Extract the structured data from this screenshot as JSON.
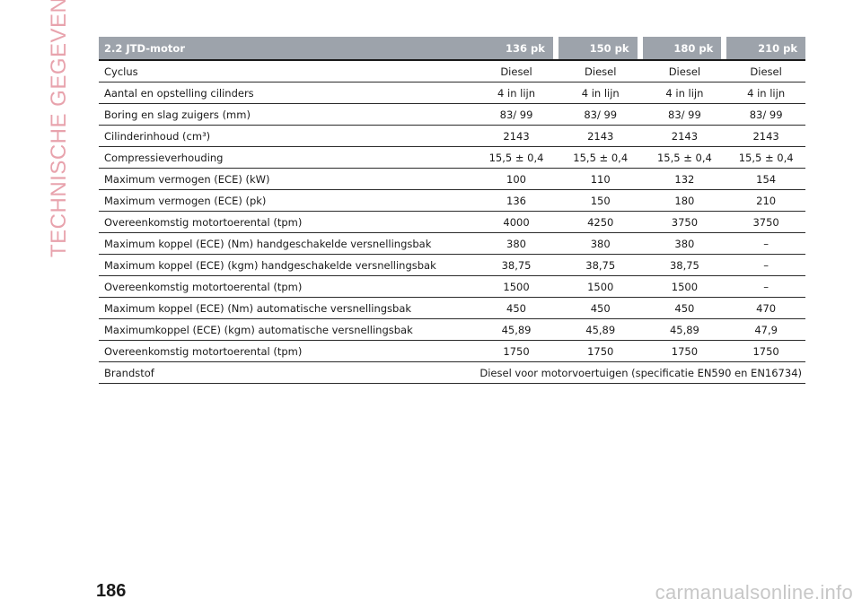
{
  "side_title": "TECHNISCHE GEGEVENS",
  "table": {
    "header": {
      "label": "2.2 JTD-motor",
      "columns": [
        "136 pk",
        "150 pk",
        "180 pk",
        "210 pk"
      ]
    },
    "rows": [
      {
        "label": "Cyclus",
        "values": [
          "Diesel",
          "Diesel",
          "Diesel",
          "Diesel"
        ]
      },
      {
        "label": "Aantal en opstelling cilinders",
        "values": [
          "4 in lijn",
          "4 in lijn",
          "4 in lijn",
          "4 in lijn"
        ]
      },
      {
        "label": "Boring en slag zuigers (mm)",
        "values": [
          "83/ 99",
          "83/ 99",
          "83/ 99",
          "83/ 99"
        ]
      },
      {
        "label": "Cilinderinhoud (cm³)",
        "values": [
          "2143",
          "2143",
          "2143",
          "2143"
        ]
      },
      {
        "label": "Compressieverhouding",
        "values": [
          "15,5 ± 0,4",
          "15,5 ± 0,4",
          "15,5 ± 0,4",
          "15,5 ± 0,4"
        ]
      },
      {
        "label": "Maximum vermogen (ECE) (kW)",
        "values": [
          "100",
          "110",
          "132",
          "154"
        ]
      },
      {
        "label": "Maximum vermogen (ECE) (pk)",
        "values": [
          "136",
          "150",
          "180",
          "210"
        ]
      },
      {
        "label": "Overeenkomstig motortoerental (tpm)",
        "values": [
          "4000",
          "4250",
          "3750",
          "3750"
        ]
      },
      {
        "label": "Maximum koppel (ECE) (Nm) handgeschakelde versnellingsbak",
        "values": [
          "380",
          "380",
          "380",
          "–"
        ]
      },
      {
        "label": "Maximum koppel (ECE) (kgm) handgeschakelde versnellingsbak",
        "values": [
          "38,75",
          "38,75",
          "38,75",
          "–"
        ]
      },
      {
        "label": "Overeenkomstig motortoerental (tpm)",
        "values": [
          "1500",
          "1500",
          "1500",
          "–"
        ]
      },
      {
        "label": "Maximum koppel (ECE) (Nm) automatische versnellingsbak",
        "values": [
          "450",
          "450",
          "450",
          "470"
        ]
      },
      {
        "label": "Maximumkoppel (ECE) (kgm) automatische versnellingsbak",
        "values": [
          "45,89",
          "45,89",
          "45,89",
          "47,9"
        ]
      },
      {
        "label": "Overeenkomstig motortoerental (tpm)",
        "values": [
          "1750",
          "1750",
          "1750",
          "1750"
        ]
      }
    ],
    "fuel_row": {
      "label": "Brandstof",
      "value": "Diesel voor motorvoertuigen (specificatie EN590 en EN16734)"
    }
  },
  "page_number": "186",
  "watermark": "carmanualsonline.info"
}
